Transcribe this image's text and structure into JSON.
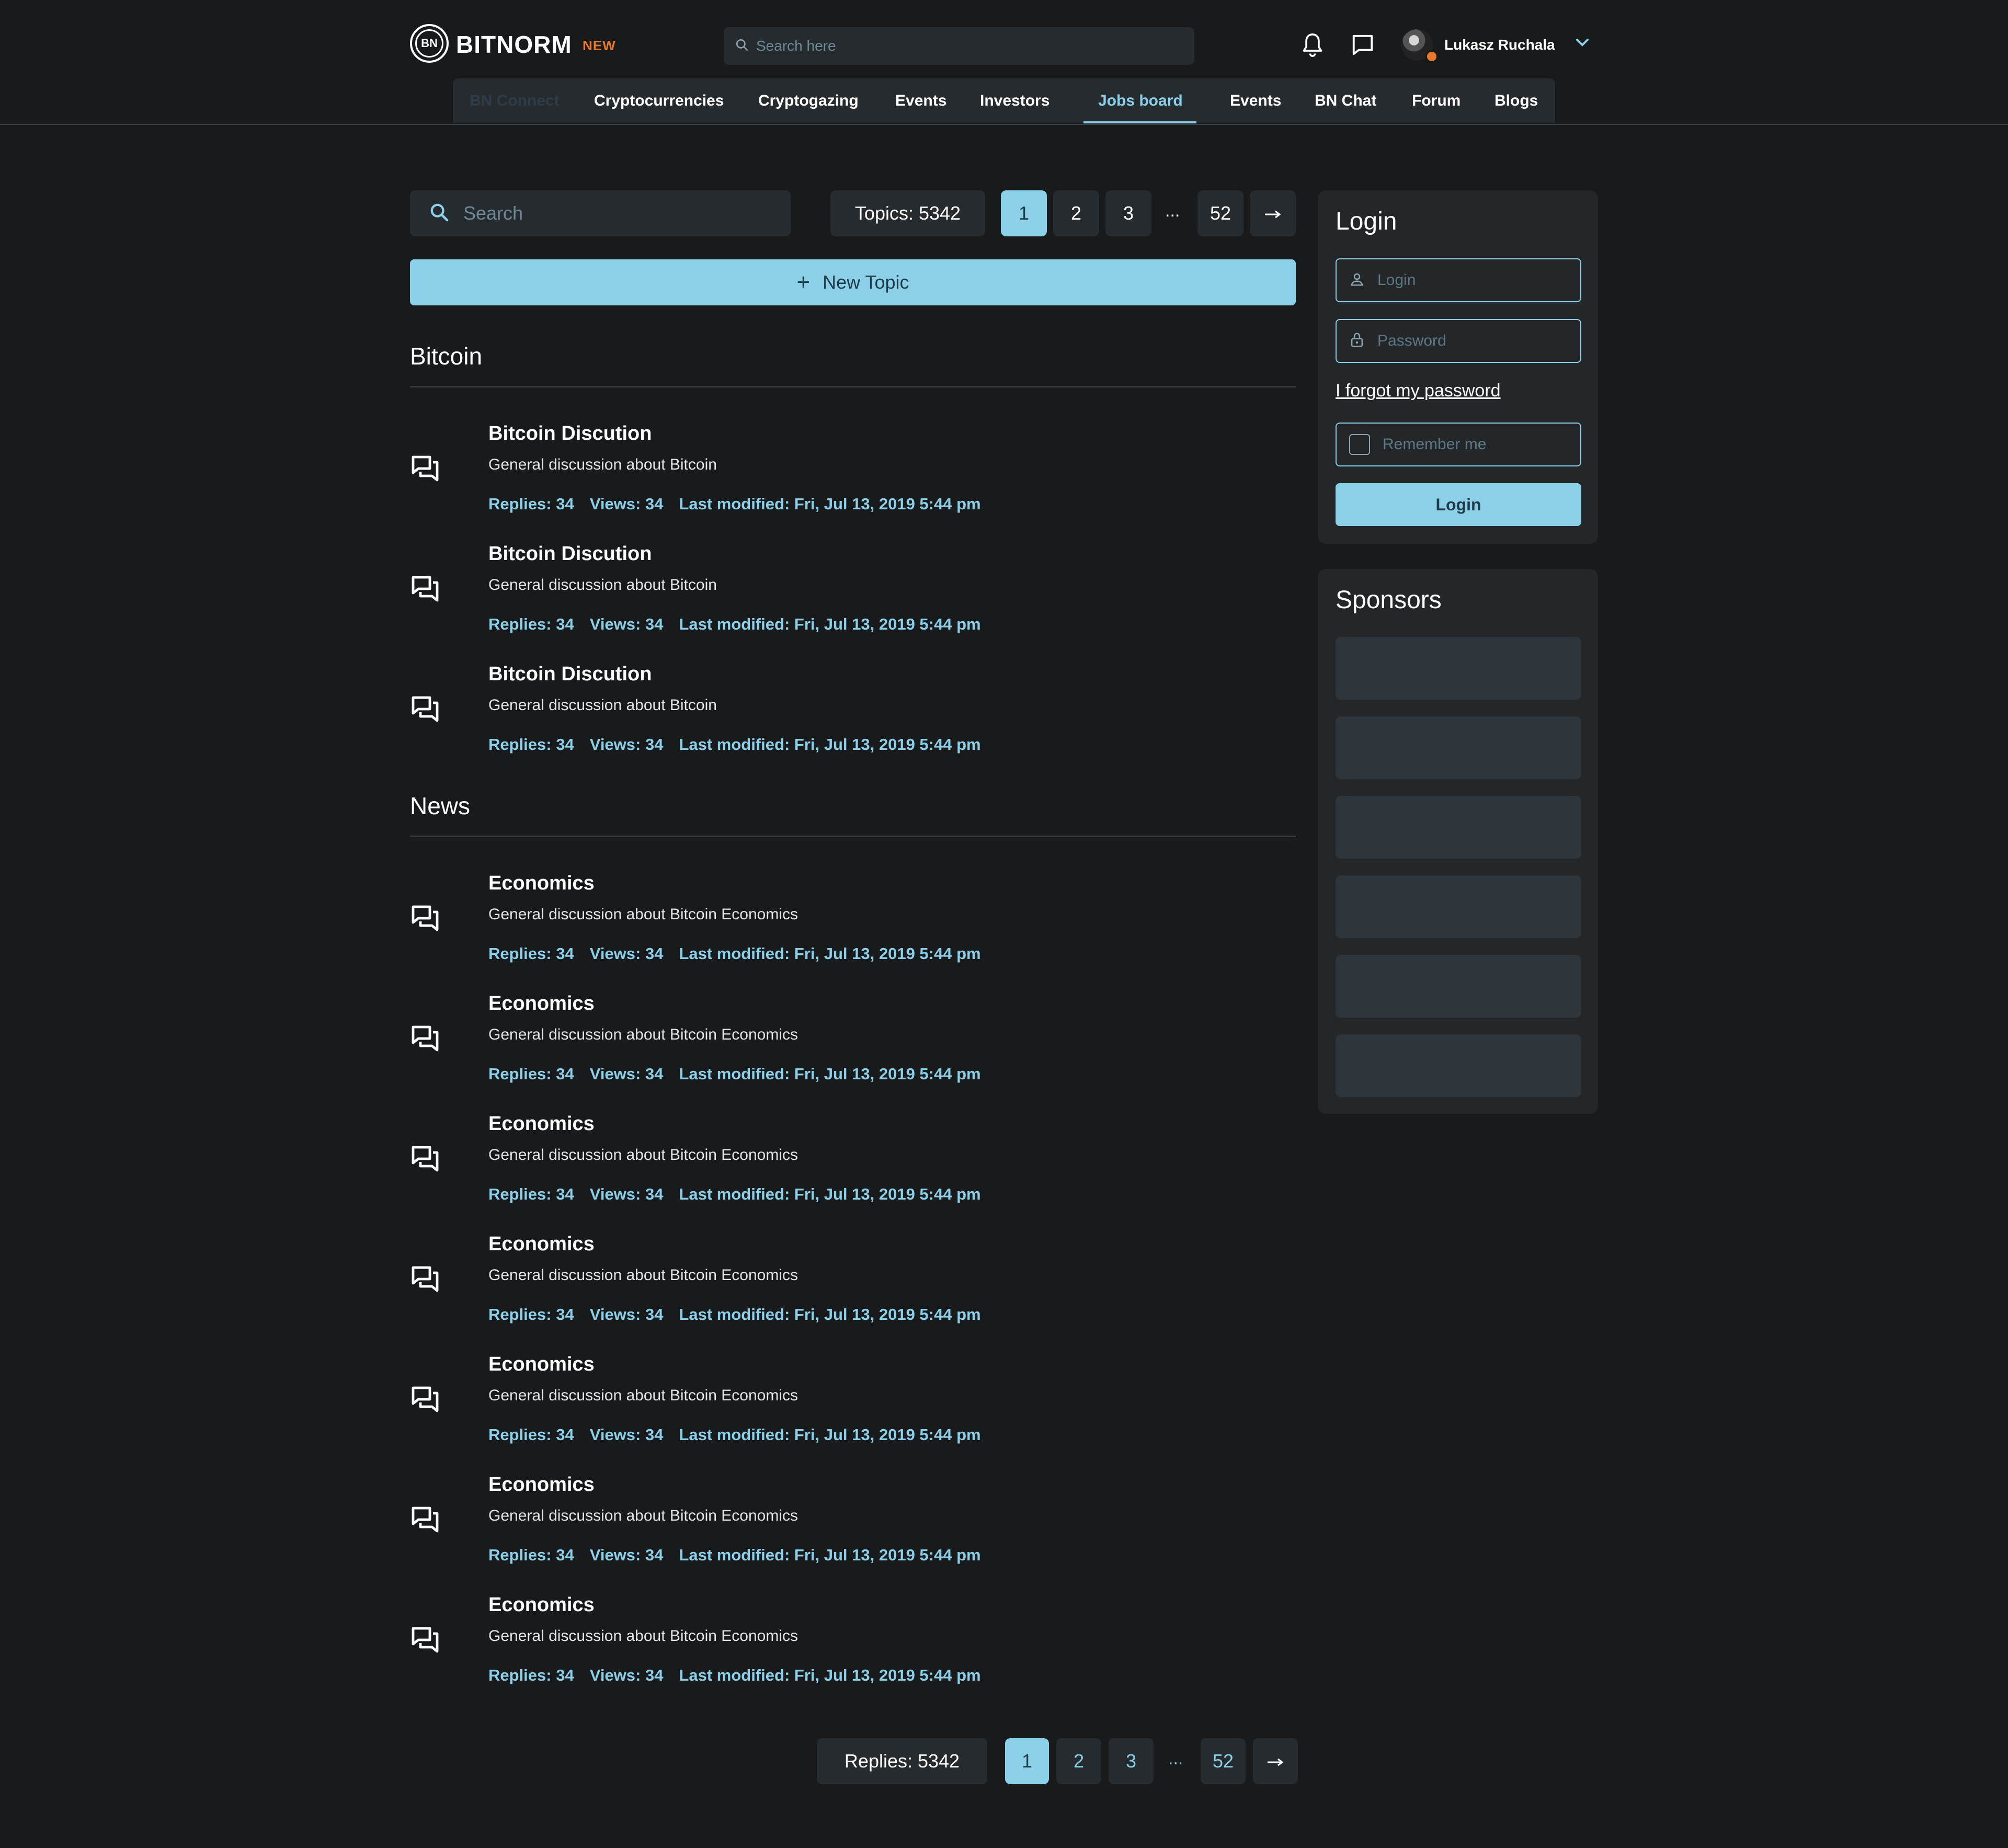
{
  "header": {
    "brand": "BITNORM",
    "brand_mark": "BN",
    "badge": "NEW",
    "search_placeholder": "Search here",
    "user_name": "Lukasz Ruchala",
    "nav": [
      {
        "label": "BN Connect",
        "state": "disabled"
      },
      {
        "label": "Cryptocurrencies"
      },
      {
        "label": "Cryptogazing"
      },
      {
        "label": "Events"
      },
      {
        "label": "Investors"
      },
      {
        "label": "Jobs board",
        "state": "active"
      },
      {
        "label": "Events"
      },
      {
        "label": "BN Chat"
      },
      {
        "label": "Forum"
      },
      {
        "label": "Blogs"
      }
    ]
  },
  "forum": {
    "search_placeholder": "Search",
    "topics_label": "Topics: 5342",
    "pages": [
      "1",
      "2",
      "3",
      "...",
      "52"
    ],
    "next_icon": "arrow-right-icon",
    "new_topic_label": "New Topic",
    "sections": [
      {
        "title": "Bitcoin",
        "topics": [
          {
            "title": "Bitcoin Discution",
            "desc": "General discussion about Bitcoin",
            "replies": "Replies: 34",
            "views": "Views: 34",
            "modified": "Last modified: Fri, Jul 13, 2019 5:44 pm"
          },
          {
            "title": "Bitcoin Discution",
            "desc": "General discussion about Bitcoin",
            "replies": "Replies: 34",
            "views": "Views: 34",
            "modified": "Last modified: Fri, Jul 13, 2019 5:44 pm"
          },
          {
            "title": "Bitcoin Discution",
            "desc": "General discussion about Bitcoin",
            "replies": "Replies: 34",
            "views": "Views: 34",
            "modified": "Last modified: Fri, Jul 13, 2019 5:44 pm"
          }
        ]
      },
      {
        "title": "News",
        "topics": [
          {
            "title": "Economics",
            "desc": "General discussion about Bitcoin Economics",
            "replies": "Replies: 34",
            "views": "Views: 34",
            "modified": "Last modified: Fri, Jul 13, 2019 5:44 pm"
          },
          {
            "title": "Economics",
            "desc": "General discussion about Bitcoin Economics",
            "replies": "Replies: 34",
            "views": "Views: 34",
            "modified": "Last modified: Fri, Jul 13, 2019 5:44 pm"
          },
          {
            "title": "Economics",
            "desc": "General discussion about Bitcoin Economics",
            "replies": "Replies: 34",
            "views": "Views: 34",
            "modified": "Last modified: Fri, Jul 13, 2019 5:44 pm"
          },
          {
            "title": "Economics",
            "desc": "General discussion about Bitcoin Economics",
            "replies": "Replies: 34",
            "views": "Views: 34",
            "modified": "Last modified: Fri, Jul 13, 2019 5:44 pm"
          },
          {
            "title": "Economics",
            "desc": "General discussion about Bitcoin Economics",
            "replies": "Replies: 34",
            "views": "Views: 34",
            "modified": "Last modified: Fri, Jul 13, 2019 5:44 pm"
          },
          {
            "title": "Economics",
            "desc": "General discussion about Bitcoin Economics",
            "replies": "Replies: 34",
            "views": "Views: 34",
            "modified": "Last modified: Fri, Jul 13, 2019 5:44 pm"
          },
          {
            "title": "Economics",
            "desc": "General discussion about Bitcoin Economics",
            "replies": "Replies: 34",
            "views": "Views: 34",
            "modified": "Last modified: Fri, Jul 13, 2019 5:44 pm"
          }
        ]
      }
    ],
    "bottom_replies_label": "Replies: 5342"
  },
  "login": {
    "title": "Login",
    "login_placeholder": "Login",
    "password_placeholder": "Password",
    "forgot": "I forgot my password",
    "remember": "Remember me",
    "button": "Login"
  },
  "sponsors": {
    "title": "Sponsors",
    "slots": 6
  },
  "colors": {
    "background": "#181a1b",
    "surface": "#262b2f",
    "accent": "#8bcfe9",
    "badge": "#e9792c"
  }
}
